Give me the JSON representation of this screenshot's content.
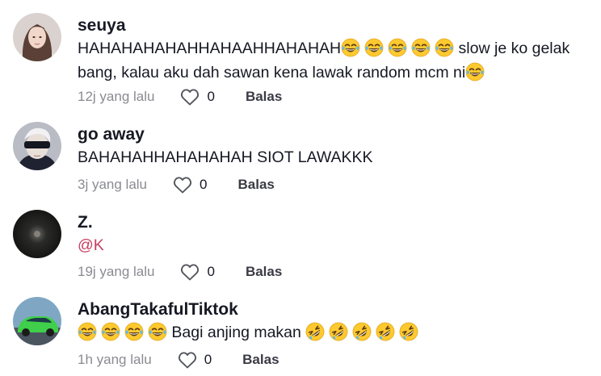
{
  "comments": [
    {
      "username": "seuya",
      "text_parts": [
        "HAHAHAHAHAHHAHAAHHAHAHAH",
        " slow je ko gelak bang, kalau aku dah sawan kena lawak random mcm ni"
      ],
      "emoji_groups": [
        {
          "icon": "tears-of-joy-emoji",
          "count": 5
        },
        {
          "icon": "tears-of-joy-emoji",
          "count": 1
        }
      ],
      "time": "12j yang lalu",
      "likes": "0",
      "reply": "Balas"
    },
    {
      "username": "go away",
      "text": "BAHAHAHHAHAHAHAH SIOT LAWAKKK",
      "time": "3j yang lalu",
      "likes": "0",
      "reply": "Balas"
    },
    {
      "username": "Z.",
      "mention": "@K",
      "time": "19j yang lalu",
      "likes": "0",
      "reply": "Balas"
    },
    {
      "username": "AbangTakafulTiktok",
      "text": " Bagi anjing makan ",
      "emoji_groups": [
        {
          "icon": "tears-of-joy-emoji",
          "count": 4
        },
        {
          "icon": "rolling-on-floor-laughing-emoji",
          "count": 5
        }
      ],
      "time": "1h yang lalu",
      "likes": "0",
      "reply": "Balas"
    }
  ],
  "colors": {
    "text": "#161823",
    "meta": "#8a8b91",
    "mention": "#c53f5f",
    "emoji_face": "#fdc92f"
  }
}
